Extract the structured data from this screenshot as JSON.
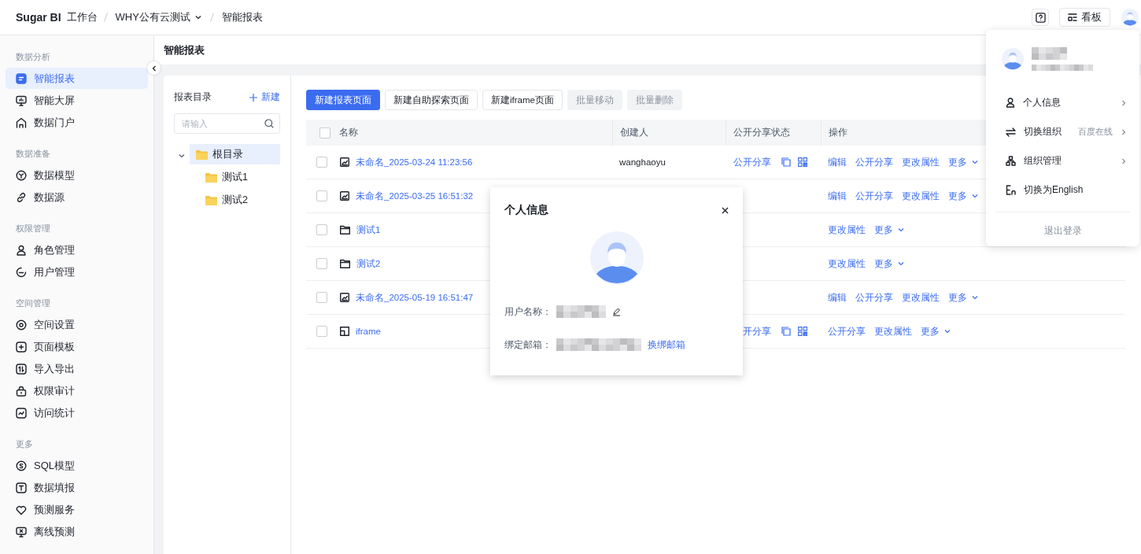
{
  "topbar": {
    "brand": "Sugar BI",
    "workspace": "工作台",
    "breadcrumb": [
      {
        "label": "WHY公有云测试",
        "kind": "dropdown"
      },
      {
        "label": "智能报表",
        "kind": "current"
      }
    ],
    "board_button": "看板"
  },
  "sidebar": {
    "sections": [
      {
        "title": "数据分析",
        "items": [
          {
            "label": "智能报表",
            "selected": true
          },
          {
            "label": "智能大屏",
            "selected": false
          },
          {
            "label": "数据门户",
            "selected": false
          }
        ]
      },
      {
        "title": "数据准备",
        "items": [
          {
            "label": "数据模型",
            "selected": false
          },
          {
            "label": "数据源",
            "selected": false
          }
        ]
      },
      {
        "title": "权限管理",
        "items": [
          {
            "label": "角色管理",
            "selected": false
          },
          {
            "label": "用户管理",
            "selected": false
          }
        ]
      },
      {
        "title": "空间管理",
        "items": [
          {
            "label": "空间设置",
            "selected": false
          },
          {
            "label": "页面模板",
            "selected": false
          },
          {
            "label": "导入导出",
            "selected": false
          },
          {
            "label": "权限审计",
            "selected": false
          },
          {
            "label": "访问统计",
            "selected": false
          }
        ]
      },
      {
        "title": "更多",
        "items": [
          {
            "label": "SQL模型",
            "selected": false
          },
          {
            "label": "数据填报",
            "selected": false
          },
          {
            "label": "预测服务",
            "selected": false
          },
          {
            "label": "离线预测",
            "selected": false
          }
        ]
      }
    ]
  },
  "page_title": "智能报表",
  "tree": {
    "title": "报表目录",
    "new_button": "新建",
    "search_placeholder": "请输入",
    "nodes": [
      {
        "label": "根目录",
        "expanded": true,
        "selected": true,
        "children": [
          {
            "label": "测试1",
            "selected": false
          },
          {
            "label": "测试2",
            "selected": false
          }
        ]
      }
    ]
  },
  "toolbar": [
    {
      "label": "新建报表页面",
      "kind": "primary",
      "disabled": false
    },
    {
      "label": "新建自助探索页面",
      "kind": "default",
      "disabled": false
    },
    {
      "label": "新建iframe页面",
      "kind": "default",
      "disabled": false
    },
    {
      "label": "批量移动",
      "kind": "default",
      "disabled": true
    },
    {
      "label": "批量删除",
      "kind": "default",
      "disabled": true
    }
  ],
  "table": {
    "all_checked": false,
    "columns": [
      "名称",
      "创建人",
      "公开分享状态",
      "操作"
    ],
    "rows": [
      {
        "kind": "report",
        "checked": false,
        "name": "未命名_2025-03-24 11:23:56",
        "creator": "wanghaoyu",
        "share": "公开分享",
        "actions": [
          {
            "label": "编辑",
            "dropdown": false
          },
          {
            "label": "公开分享",
            "dropdown": false
          },
          {
            "label": "更改属性",
            "dropdown": false
          },
          {
            "label": "更多",
            "dropdown": true
          }
        ]
      },
      {
        "kind": "report",
        "checked": false,
        "name": "未命名_2025-03-25 16:51:32",
        "actions": [
          {
            "label": "编辑",
            "dropdown": false
          },
          {
            "label": "公开分享",
            "dropdown": false
          },
          {
            "label": "更改属性",
            "dropdown": false
          },
          {
            "label": "更多",
            "dropdown": true
          }
        ]
      },
      {
        "kind": "folder",
        "checked": false,
        "name": "测试1",
        "actions": [
          {
            "label": "更改属性",
            "dropdown": false
          },
          {
            "label": "更多",
            "dropdown": true
          }
        ]
      },
      {
        "kind": "folder",
        "checked": false,
        "name": "测试2",
        "actions": [
          {
            "label": "更改属性",
            "dropdown": false
          },
          {
            "label": "更多",
            "dropdown": true
          }
        ]
      },
      {
        "kind": "report",
        "checked": false,
        "name": "未命名_2025-05-19 16:51:47",
        "actions": [
          {
            "label": "编辑",
            "dropdown": false
          },
          {
            "label": "公开分享",
            "dropdown": false
          },
          {
            "label": "更改属性",
            "dropdown": false
          },
          {
            "label": "更多",
            "dropdown": true
          }
        ]
      },
      {
        "kind": "iframe",
        "checked": false,
        "name": "iframe",
        "share": "开分享",
        "actions": [
          {
            "label": "公开分享",
            "dropdown": false
          },
          {
            "label": "更改属性",
            "dropdown": false
          },
          {
            "label": "更多",
            "dropdown": true
          }
        ]
      }
    ]
  },
  "modal": {
    "title": "个人信息",
    "fields": [
      {
        "label": "用户名称：",
        "kind": "editable"
      },
      {
        "label": "绑定邮箱：",
        "kind": "link",
        "link": "换绑邮箱"
      }
    ]
  },
  "user_menu": {
    "items": [
      {
        "label": "个人信息",
        "submenu": true
      },
      {
        "label": "切换组织",
        "detail": "百度在线",
        "submenu": true
      },
      {
        "label": "组织管理",
        "submenu": true
      },
      {
        "label": "切换为English",
        "submenu": false
      }
    ],
    "logout": "退出登录"
  }
}
